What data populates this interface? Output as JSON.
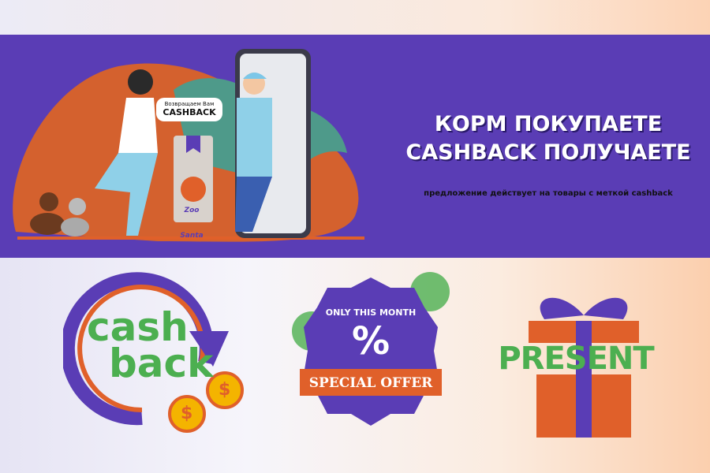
{
  "banner": {
    "bubble_small": "Возвращаем Вам",
    "bubble_big": "CASHBACK",
    "bag_brand_line1": "Zoo",
    "bag_brand_line2": "Santa",
    "headline_line1": "КОРМ ПОКУПАЕТЕ",
    "headline_line2": "CASHBACK ПОЛУЧАЕТЕ",
    "subtitle": "предложение действует на товары с меткой cashback"
  },
  "badges": {
    "cashback_line1": "cash",
    "cashback_line2": "back",
    "coin_symbol": "$",
    "offer_top": "ONLY THIS MONTH",
    "offer_symbol": "%",
    "offer_ribbon": "SPECIAL OFFER",
    "present": "PRESENT"
  },
  "colors": {
    "banner": "#5a3db5",
    "orange": "#e0602a",
    "green": "#4caf50",
    "gold": "#f4b400"
  }
}
